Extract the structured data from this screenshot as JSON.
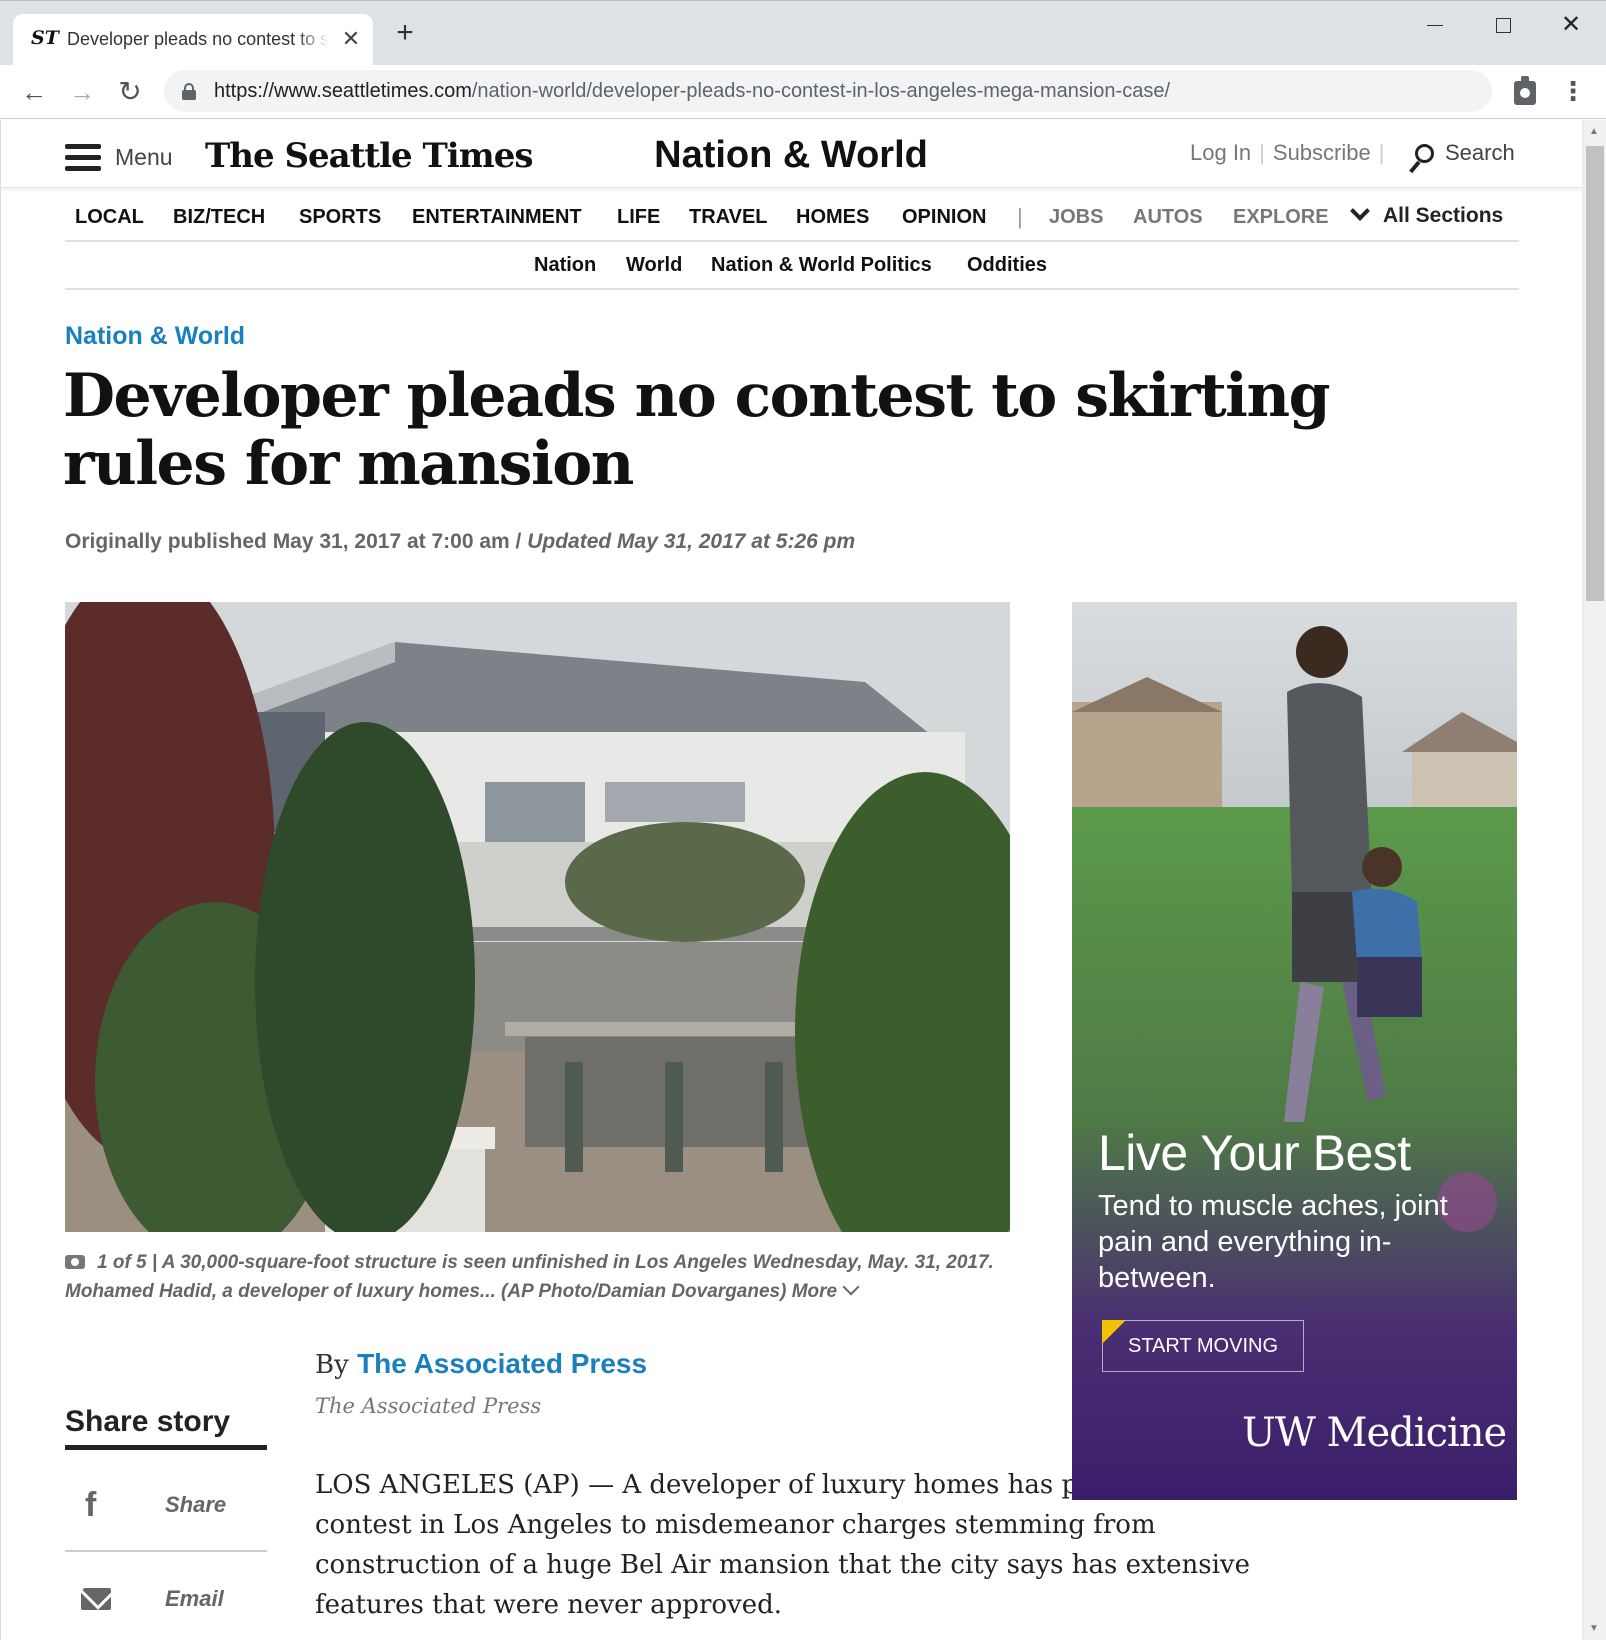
{
  "browser": {
    "tab_title": "Developer pleads no contest to skirting rules for mansion",
    "tab_favicon": "ST",
    "new_tab": "+",
    "url_host": "https://www.seattletimes.com",
    "url_path": "/nation-world/developer-pleads-no-contest-in-los-angeles-mega-mansion-case/"
  },
  "header": {
    "menu_label": "Menu",
    "logo": "The Seattle Times",
    "section_title": "Nation & World",
    "login": "Log In",
    "subscribe": "Subscribe",
    "search": "Search"
  },
  "main_nav": {
    "items": [
      "LOCAL",
      "BIZ/TECH",
      "SPORTS",
      "ENTERTAINMENT",
      "LIFE",
      "TRAVEL",
      "HOMES",
      "OPINION"
    ],
    "divider": "|",
    "grey_items": [
      "JOBS",
      "AUTOS",
      "EXPLORE"
    ],
    "all_sections": "All Sections"
  },
  "sub_nav": {
    "items": [
      "Nation",
      "World",
      "Nation & World Politics",
      "Oddities"
    ]
  },
  "article": {
    "kicker": "Nation & World",
    "headline": "Developer pleads no contest to skirting rules for mansion",
    "published": "Originally published May 31, 2017 at 7:00 am",
    "date_sep": " / ",
    "updated": "Updated May 31, 2017 at 5:26 pm",
    "caption_count": "1 of 5",
    "caption_text": " | A 30,000-square-foot structure is seen unfinished in Los Angeles Wednesday, May. 31, 2017. Mohamed Hadid, a developer of luxury homes... (AP Photo/Damian Dovarganes) More",
    "byline_prefix": "By ",
    "author": "The Associated Press",
    "author_org": "The Associated Press",
    "body": "LOS ANGELES (AP) — A developer of luxury homes has pleaded no contest in Los Angeles to misdemeanor charges stemming from construction of a huge Bel Air mansion that the city says has extensive features that were never approved."
  },
  "share": {
    "title": "Share story",
    "facebook_label": "Share",
    "facebook_glyph": "f",
    "email_label": "Email"
  },
  "ad": {
    "headline": "Live Your Best",
    "subtext": "Tend to muscle aches, joint pain and everything in-between.",
    "cta": "START MOVING",
    "brand": "UW Medicine"
  },
  "colors": {
    "link_blue": "#1a7fbf",
    "ad_purple": "#3a1e6a"
  }
}
